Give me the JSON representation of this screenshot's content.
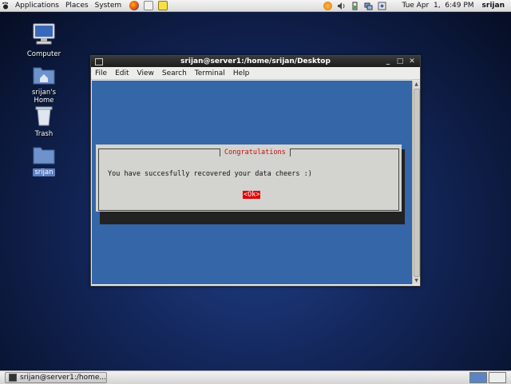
{
  "top_panel": {
    "menus": [
      "Applications",
      "Places",
      "System"
    ],
    "clock": "Tue Apr  1,  6:49 PM",
    "user": "srijan"
  },
  "desktop": {
    "icons": [
      {
        "label": "Computer",
        "icon": "computer-icon"
      },
      {
        "label": "srijan's Home",
        "icon": "home-folder-icon"
      },
      {
        "label": "Trash",
        "icon": "trash-icon"
      },
      {
        "label": "srijan",
        "icon": "folder-icon"
      }
    ]
  },
  "window": {
    "title": "srijan@server1:/home/srijan/Desktop",
    "menu": [
      "File",
      "Edit",
      "View",
      "Search",
      "Terminal",
      "Help"
    ]
  },
  "dialog": {
    "title": "Congratulations",
    "message": "You have succesfully recovered your data cheers :)",
    "ok_label": "<Ok>"
  },
  "taskbar": {
    "window_label": "srijan@server1:/home..."
  },
  "colors": {
    "terminal_bg": "#3566a8",
    "dialog_bg": "#d3d3cf",
    "dialog_title": "#c01010",
    "ok_bg": "#e00000"
  }
}
